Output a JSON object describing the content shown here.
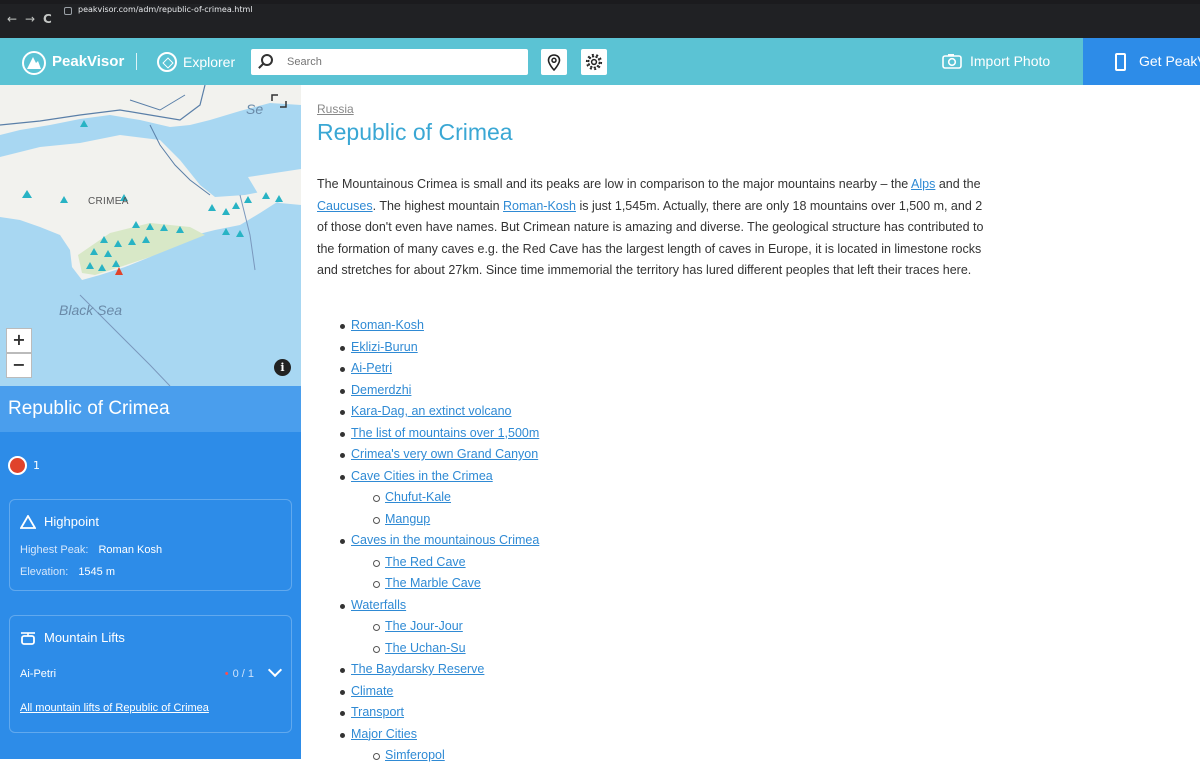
{
  "browser": {
    "url": "peakvisor.com/adm/republic-of-crimea.html",
    "back": "←",
    "forward": "→",
    "reload": "C"
  },
  "header": {
    "brand": "PeakVisor",
    "explorer_label": "Explorer",
    "search_placeholder": "Search",
    "import_label": "Import Photo",
    "get_label": "Get PeakVisor",
    "colors": {
      "bar": "#5bc3d4",
      "get_button": "#2d8ce8"
    }
  },
  "map": {
    "labels": {
      "crimea": "CRIMEA",
      "black_sea": "Black Sea",
      "sea_partial": "Se"
    },
    "zoom_in": "+",
    "zoom_out": "−",
    "info": "i"
  },
  "sidebar": {
    "title": "Republic of Crimea",
    "rank_count": "1",
    "highpoint": {
      "title": "Highpoint",
      "highest_peak_label": "Highest Peak:",
      "highest_peak_value": "Roman Kosh",
      "elevation_label": "Elevation:",
      "elevation_value": "1545 m"
    },
    "lifts": {
      "title": "Mountain Lifts",
      "row_name": "Ai-Petri",
      "row_count": "0 / 1",
      "all_link": "All mountain lifts of Republic of Crimea"
    },
    "colors": {
      "panel": "#2d8ce8",
      "title_bar": "#4a9eed"
    }
  },
  "content": {
    "breadcrumb": "Russia",
    "title": "Republic of Crimea",
    "para": {
      "p1": "The Mountainous Crimea is small and its peaks are low in comparison to the major mountains nearby – the ",
      "alps": "Alps",
      "p2": " and the ",
      "caucuses": "Caucuses",
      "p3": ". The highest mountain ",
      "roman": "Roman-Kosh",
      "p4": " is just 1,545m. Actually, there are only 18 mountains over 1,500 m, and 2 of those don't even have names. But Crimean nature is amazing and diverse. The geological structure has contributed to the formation of many caves e.g. the Red Cave has the largest length of caves in Europe, it is located in limestone rocks and stretches for about 27km. Since time immemorial the territory has lured different peoples that left their traces here."
    },
    "toc": [
      {
        "label": "Roman-Kosh",
        "sub": false
      },
      {
        "label": "Eklizi-Burun",
        "sub": false
      },
      {
        "label": "Ai-Petri",
        "sub": false
      },
      {
        "label": "Demerdzhi",
        "sub": false
      },
      {
        "label": "Kara-Dag, an extinct volcano",
        "sub": false
      },
      {
        "label": "The list of mountains over 1,500m",
        "sub": false
      },
      {
        "label": "Crimea's very own Grand Canyon",
        "sub": false
      },
      {
        "label": "Cave Cities in the Crimea",
        "sub": false
      },
      {
        "label": "Chufut-Kale",
        "sub": true
      },
      {
        "label": "Mangup",
        "sub": true
      },
      {
        "label": "Caves in the mountainous Crimea",
        "sub": false
      },
      {
        "label": "The Red Cave",
        "sub": true
      },
      {
        "label": "The Marble Cave",
        "sub": true
      },
      {
        "label": "Waterfalls",
        "sub": false
      },
      {
        "label": "The Jour-Jour",
        "sub": true
      },
      {
        "label": "The Uchan-Su",
        "sub": true
      },
      {
        "label": "The Baydarsky Reserve",
        "sub": false
      },
      {
        "label": "Climate",
        "sub": false
      },
      {
        "label": "Transport",
        "sub": false
      },
      {
        "label": "Major Cities",
        "sub": false
      },
      {
        "label": "Simferopol",
        "sub": true
      }
    ],
    "colors": {
      "title": "#3aa7d4",
      "link": "#2f8ad4"
    }
  }
}
